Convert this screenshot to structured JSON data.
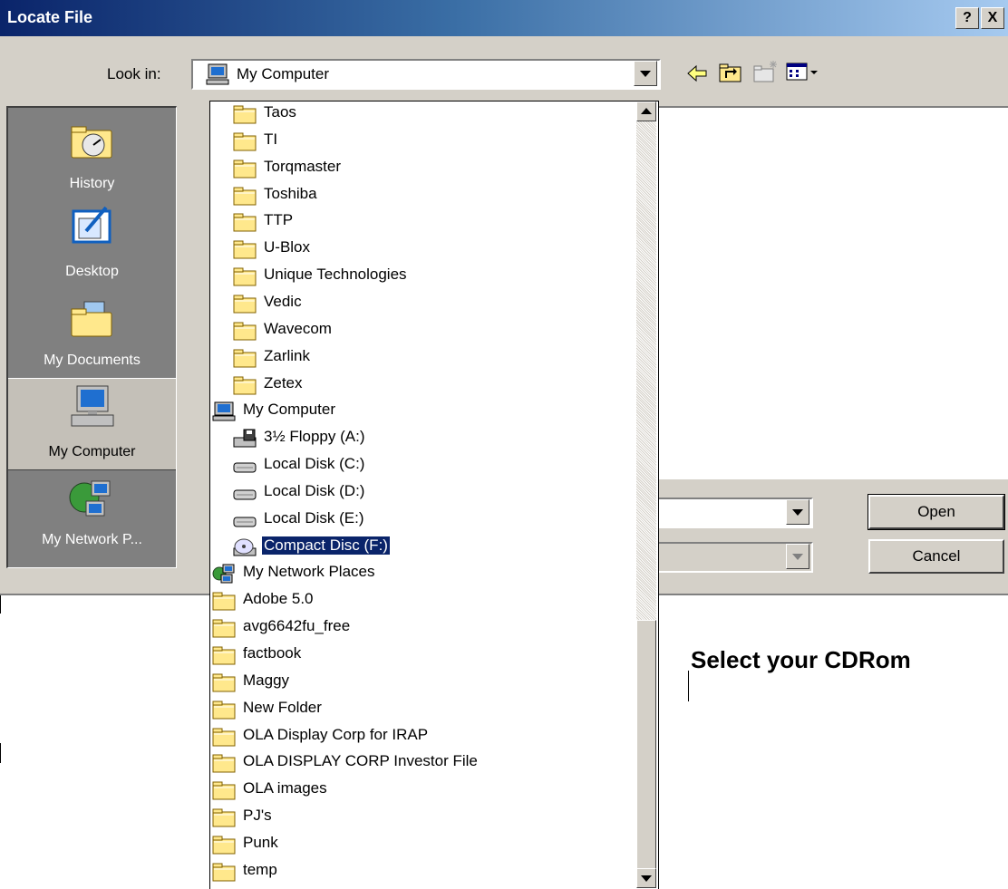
{
  "dialog": {
    "title": "Locate File",
    "help_btn": "?",
    "close_btn": "X"
  },
  "lookin": {
    "label": "Look in:",
    "value": "My Computer"
  },
  "places": [
    {
      "label": "History",
      "icon": "history-icon"
    },
    {
      "label": "Desktop",
      "icon": "desktop-icon"
    },
    {
      "label": "My Documents",
      "icon": "my-documents-icon"
    },
    {
      "label": "My Computer",
      "icon": "my-computer-icon",
      "selected": true
    },
    {
      "label": "My Network P...",
      "icon": "network-icon"
    }
  ],
  "buttons": {
    "open": "Open",
    "cancel": "Cancel"
  },
  "dropdown_items": [
    {
      "label": "Taos",
      "icon": "folder-icon",
      "indent": 1
    },
    {
      "label": "TI",
      "icon": "folder-icon",
      "indent": 1
    },
    {
      "label": "Torqmaster",
      "icon": "folder-icon",
      "indent": 1
    },
    {
      "label": "Toshiba",
      "icon": "folder-icon",
      "indent": 1
    },
    {
      "label": "TTP",
      "icon": "folder-icon",
      "indent": 1
    },
    {
      "label": "U-Blox",
      "icon": "folder-icon",
      "indent": 1
    },
    {
      "label": "Unique Technologies",
      "icon": "folder-icon",
      "indent": 1
    },
    {
      "label": "Vedic",
      "icon": "folder-icon",
      "indent": 1
    },
    {
      "label": "Wavecom",
      "icon": "folder-icon",
      "indent": 1
    },
    {
      "label": "Zarlink",
      "icon": "folder-icon",
      "indent": 1
    },
    {
      "label": "Zetex",
      "icon": "folder-icon",
      "indent": 1
    },
    {
      "label": "My Computer",
      "icon": "computer-icon",
      "indent": 0
    },
    {
      "label": "3½ Floppy (A:)",
      "icon": "floppy-icon",
      "indent": 1
    },
    {
      "label": "Local Disk (C:)",
      "icon": "disk-icon",
      "indent": 1
    },
    {
      "label": "Local Disk (D:)",
      "icon": "disk-icon",
      "indent": 1
    },
    {
      "label": "Local Disk (E:)",
      "icon": "disk-icon",
      "indent": 1
    },
    {
      "label": "Compact Disc (F:)",
      "icon": "cd-icon",
      "indent": 1,
      "highlighted": true
    },
    {
      "label": "My Network Places",
      "icon": "network-icon",
      "indent": 0
    },
    {
      "label": "Adobe 5.0",
      "icon": "folder-icon",
      "indent": 0
    },
    {
      "label": "avg6642fu_free",
      "icon": "folder-icon",
      "indent": 0
    },
    {
      "label": "factbook",
      "icon": "folder-icon",
      "indent": 0
    },
    {
      "label": "Maggy",
      "icon": "folder-icon",
      "indent": 0
    },
    {
      "label": "New Folder",
      "icon": "folder-icon",
      "indent": 0
    },
    {
      "label": "OLA Display Corp for IRAP",
      "icon": "folder-icon",
      "indent": 0
    },
    {
      "label": "OLA DISPLAY CORP Investor File",
      "icon": "folder-icon",
      "indent": 0
    },
    {
      "label": "OLA images",
      "icon": "folder-icon",
      "indent": 0
    },
    {
      "label": "PJ's",
      "icon": "folder-icon",
      "indent": 0
    },
    {
      "label": "Punk",
      "icon": "folder-icon",
      "indent": 0
    },
    {
      "label": "temp",
      "icon": "folder-icon",
      "indent": 0
    }
  ],
  "caption": "Select your CDRom",
  "colors": {
    "title_start": "#0a246a",
    "title_end": "#a6caf0",
    "face": "#d4d0c8",
    "highlight": "#0a246a"
  }
}
